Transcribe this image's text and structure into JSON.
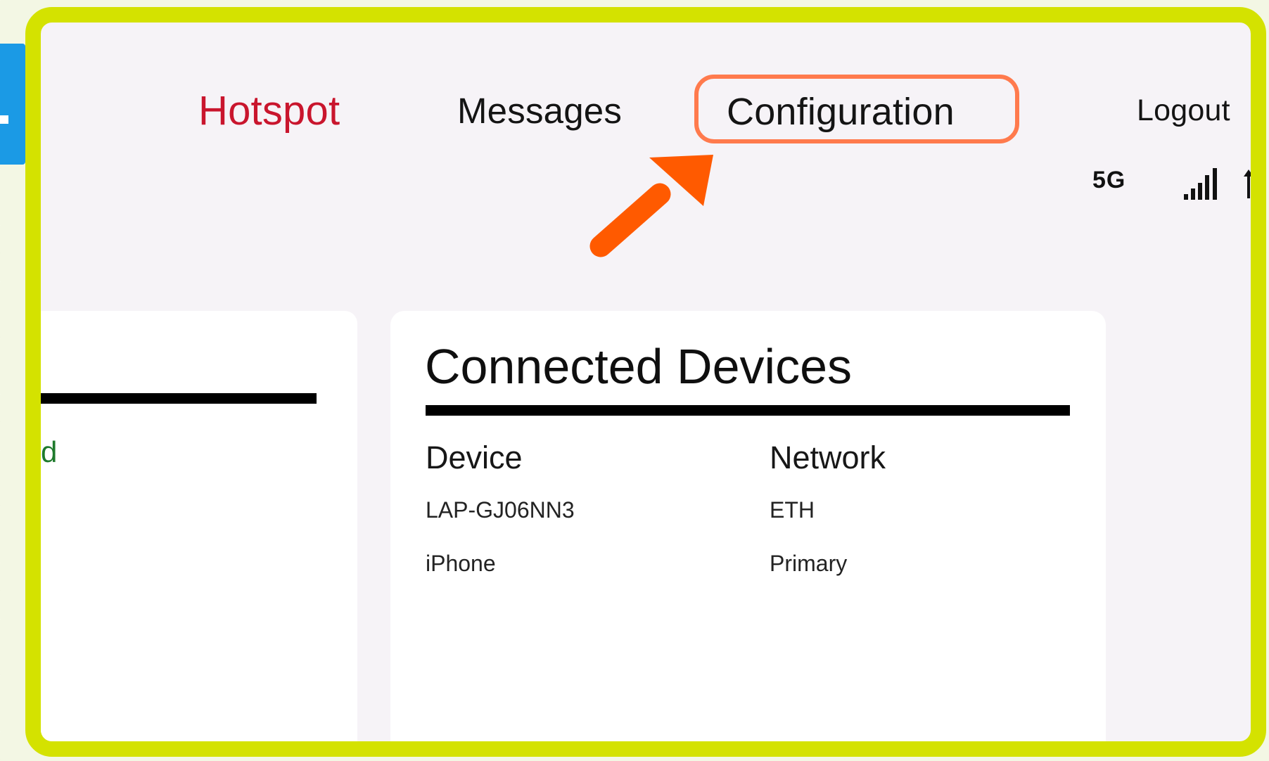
{
  "nav": {
    "hotspot": "Hotspot",
    "messages": "Messages",
    "configuration": "Configuration",
    "logout": "Logout"
  },
  "status": {
    "network_type": "5G",
    "signal_icon": "signal-icon",
    "data_icon": "data-transfer-icon"
  },
  "left_card": {
    "partial_text": "d"
  },
  "connected_devices": {
    "title": "Connected Devices",
    "columns": [
      "Device",
      "Network"
    ],
    "rows": [
      {
        "device": "LAP-GJ06NN3",
        "network": "ETH"
      },
      {
        "device": "iPhone",
        "network": "Primary"
      }
    ]
  },
  "annotation": {
    "highlight_target": "Configuration",
    "arrow_icon": "callout-arrow-icon"
  },
  "colors": {
    "frame": "#d4e200",
    "highlight": "#ff7a4d",
    "arrow": "#ff5a00",
    "hotspot": "#c9152d",
    "tab": "#1b9ae5"
  }
}
